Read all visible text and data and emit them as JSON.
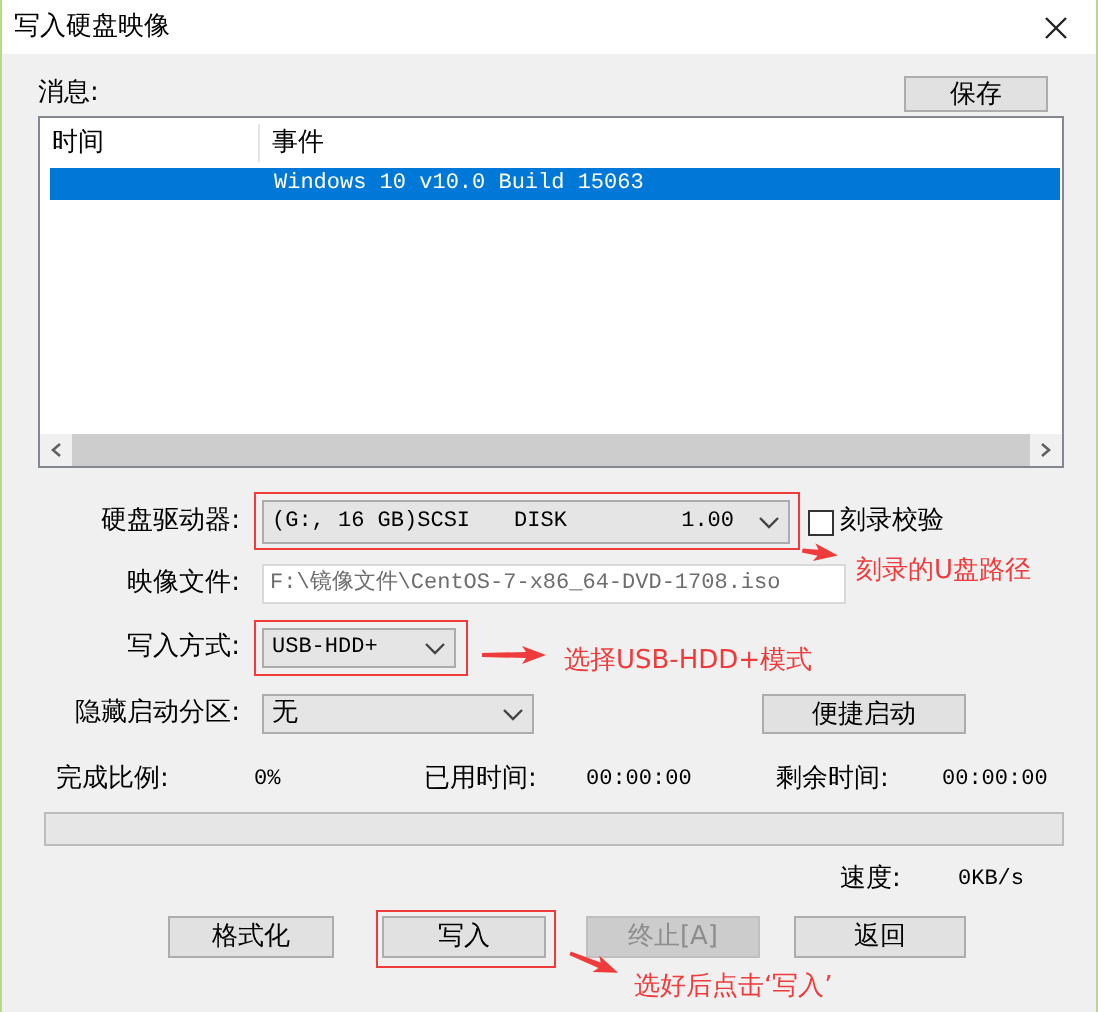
{
  "window": {
    "title": "写入硬盘映像"
  },
  "messages": {
    "label": "消息:",
    "save_button": "保存",
    "columns": [
      "时间",
      "事件"
    ],
    "rows": [
      {
        "event": "Windows 10 v10.0 Build 15063",
        "selected": true
      }
    ]
  },
  "form": {
    "drive": {
      "label": "硬盘驱动器:",
      "parts": [
        "(G:, 16 GB)SCSI",
        "DISK",
        "1.00"
      ]
    },
    "verify": {
      "label": "刻录校验",
      "checked": false
    },
    "image_file": {
      "label": "映像文件:",
      "value": "F:\\镜像文件\\CentOS-7-x86_64-DVD-1708.iso"
    },
    "write_mode": {
      "label": "写入方式:",
      "value": "USB-HDD+"
    },
    "hidden_partition": {
      "label": "隐藏启动分区:",
      "value": "无"
    },
    "quick_boot_button": "便捷启动"
  },
  "progress": {
    "stats": [
      {
        "label": "完成比例:",
        "value": "0%"
      },
      {
        "label": "已用时间:",
        "value": "00:00:00"
      },
      {
        "label": "剩余时间:",
        "value": "00:00:00"
      }
    ],
    "level": 0,
    "speed_label": "速度:",
    "speed": "0KB/s"
  },
  "buttons": [
    {
      "label": "格式化",
      "disabled": false
    },
    {
      "label": "写入",
      "disabled": false
    },
    {
      "label": "终止[A]",
      "disabled": true
    },
    {
      "label": "返回",
      "disabled": false
    }
  ],
  "annotations": [
    "刻录的U盘路径",
    "选择USB-HDD+模式",
    "选好后点击‘写入’"
  ]
}
